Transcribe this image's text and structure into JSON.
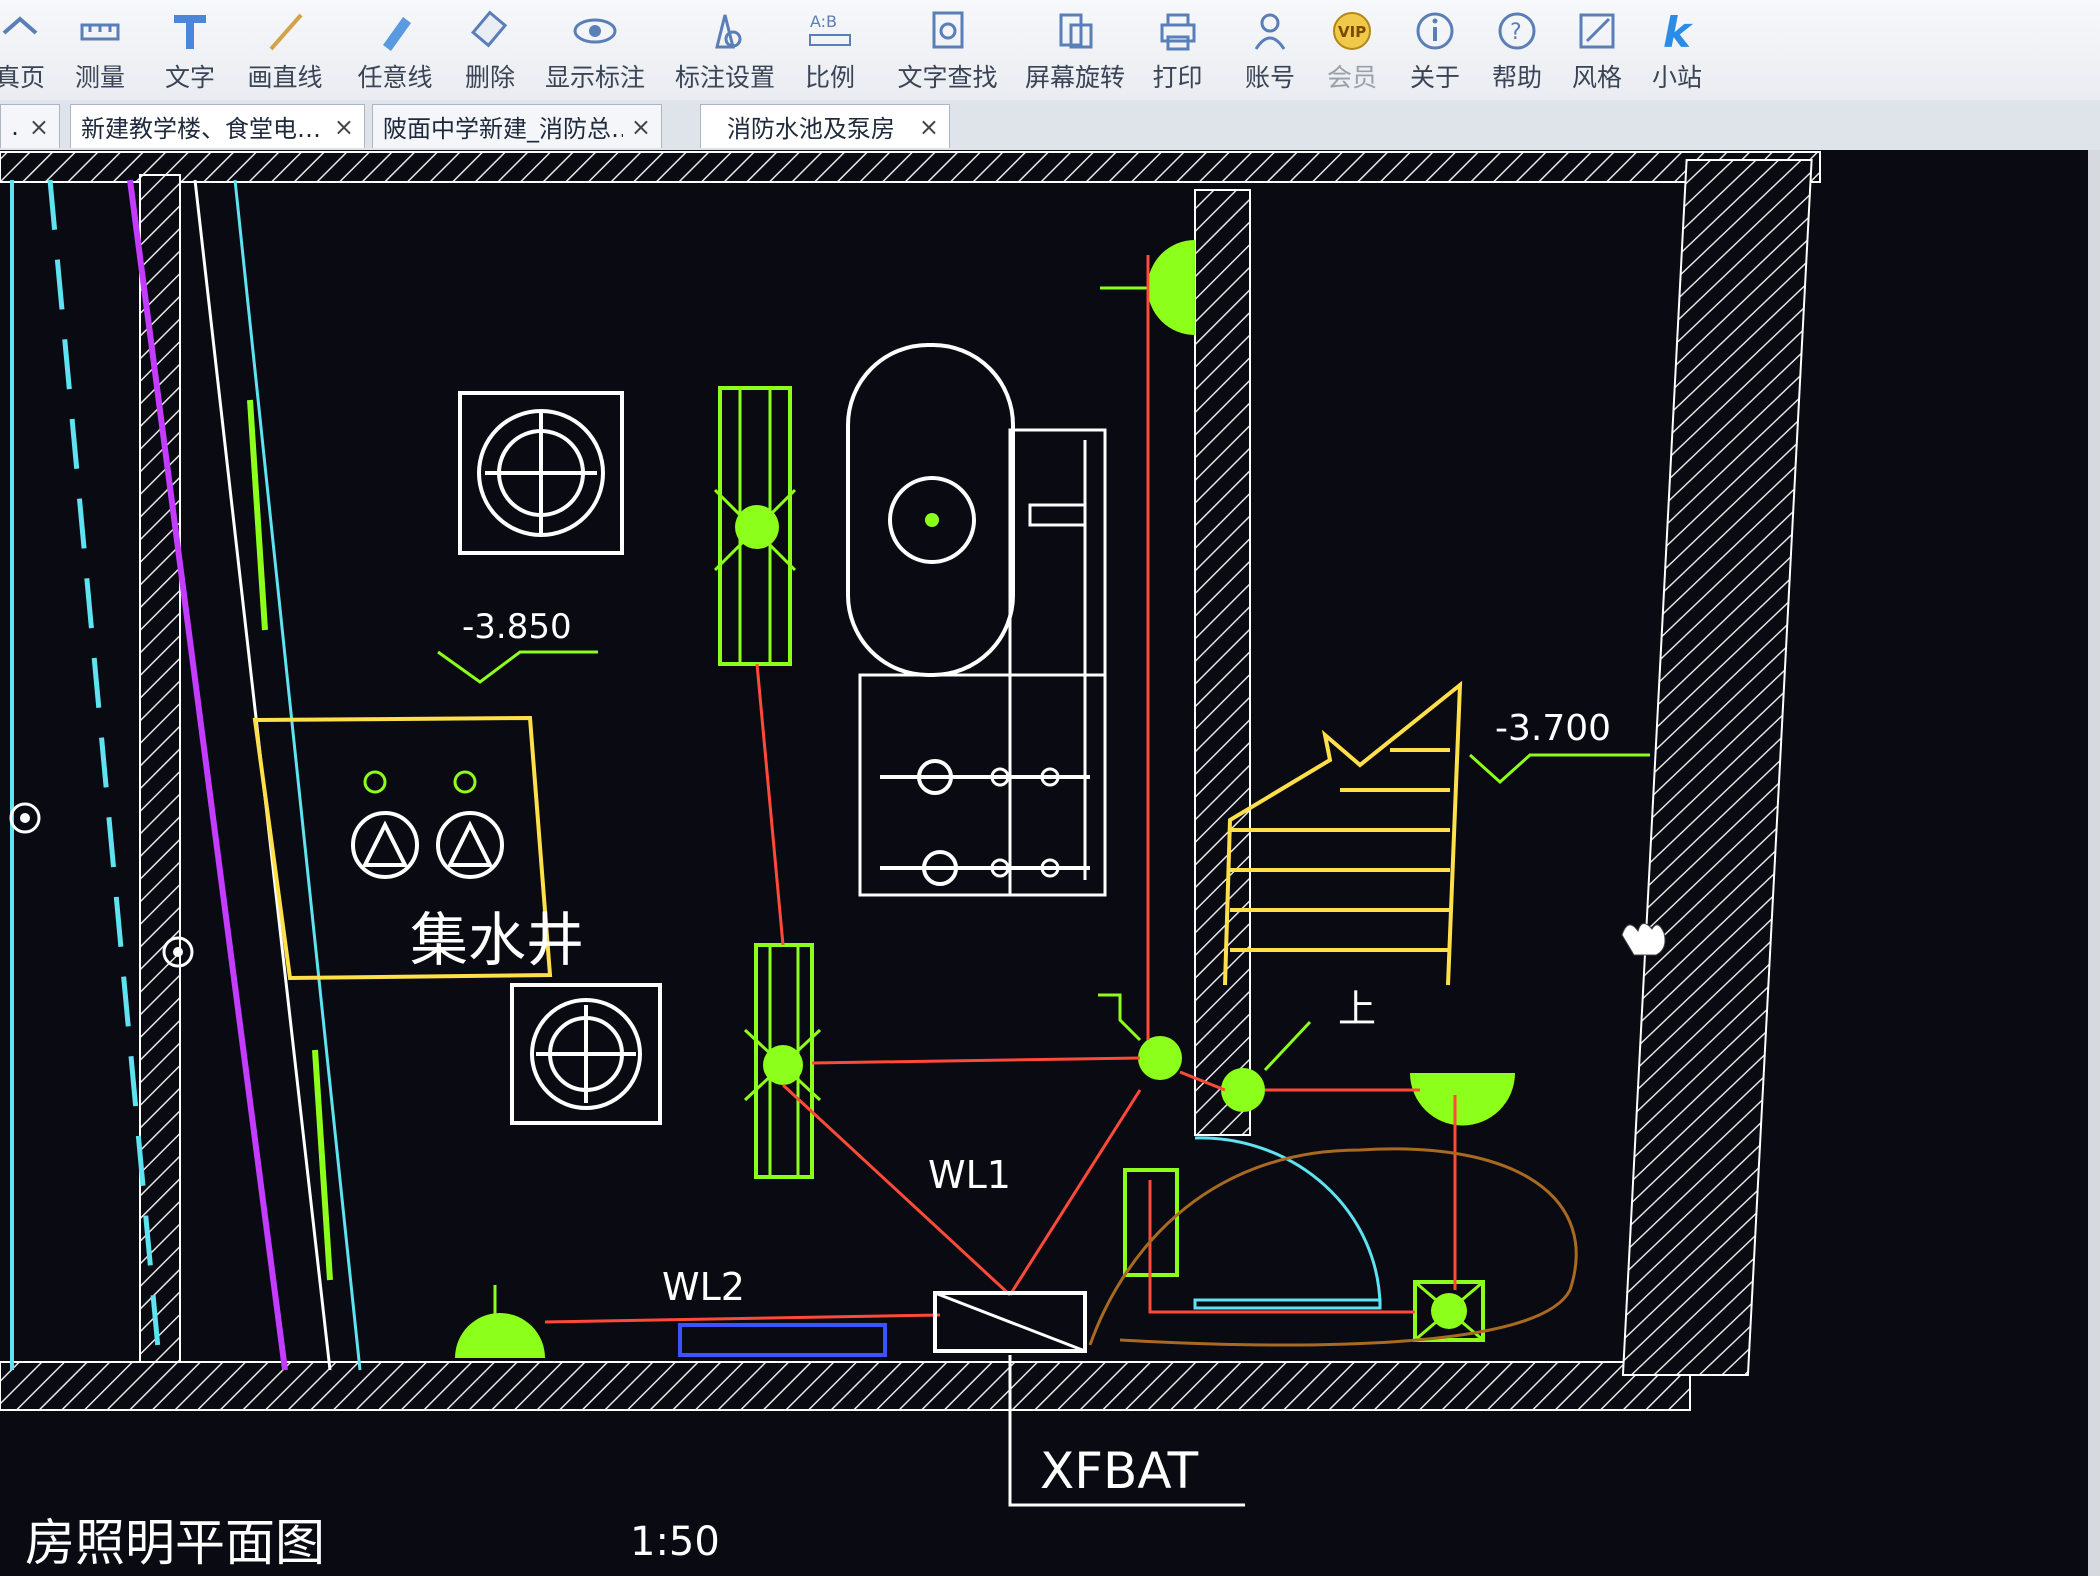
{
  "toolbar": {
    "items": [
      {
        "label": "真页",
        "icon": "home-icon"
      },
      {
        "label": "测量",
        "icon": "measure-icon"
      },
      {
        "label": "文字",
        "icon": "text-icon"
      },
      {
        "label": "画直线",
        "icon": "line-icon"
      },
      {
        "label": "任意线",
        "icon": "pen-icon"
      },
      {
        "label": "删除",
        "icon": "eraser-icon"
      },
      {
        "label": "显示标注",
        "icon": "eye-icon"
      },
      {
        "label": "标注设置",
        "icon": "annotation-settings-icon"
      },
      {
        "label": "比例",
        "icon": "scale-icon"
      },
      {
        "label": "文字查找",
        "icon": "text-search-icon"
      },
      {
        "label": "屏幕旋转",
        "icon": "rotate-icon"
      },
      {
        "label": "打印",
        "icon": "printer-icon"
      },
      {
        "label": "账号",
        "icon": "user-icon"
      },
      {
        "label": "会员",
        "icon": "vip-icon"
      },
      {
        "label": "关于",
        "icon": "info-icon"
      },
      {
        "label": "帮助",
        "icon": "help-icon"
      },
      {
        "label": "风格",
        "icon": "style-icon"
      },
      {
        "label": "小站",
        "icon": "k-logo-icon"
      }
    ],
    "vip_badge": "VIP"
  },
  "tabs": [
    {
      "label": "…",
      "close": "×"
    },
    {
      "label": "新建教学楼、食堂电…",
      "close": "×"
    },
    {
      "label": "陂面中学新建_消防总…",
      "close": "×"
    },
    {
      "label": "消防水池及泵房",
      "close": "×"
    }
  ],
  "drawing": {
    "elevation_left": "-3.850",
    "elevation_right": "-3.700",
    "sump_label": "集水井",
    "stair_label": "上",
    "wl1": "WL1",
    "wl2": "WL2",
    "panel_label": "XFBAT",
    "drawing_title": "房照明平面图",
    "scale": "1:50"
  },
  "colors": {
    "background": "#0a0a12",
    "wall": "#ffffff",
    "wire": "#ff4a3a",
    "fixture": "#8cff1a",
    "yellow": "#ffe04a",
    "cyan": "#5fe3f0",
    "magenta": "#c33cff",
    "blue": "#3a55ff",
    "brown": "#a86a20"
  }
}
